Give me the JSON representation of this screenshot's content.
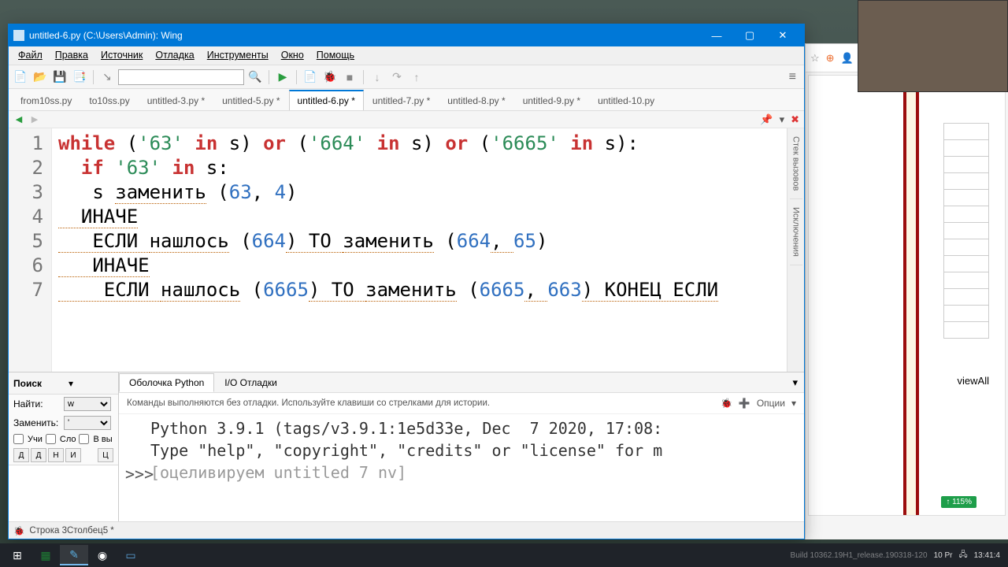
{
  "window": {
    "title": "untitled-6.py (C:\\Users\\Admin): Wing"
  },
  "menu": [
    "Файл",
    "Правка",
    "Источник",
    "Отладка",
    "Инструменты",
    "Окно",
    "Помощь"
  ],
  "tabs": [
    {
      "label": "from10ss.py",
      "active": false
    },
    {
      "label": "to10ss.py",
      "active": false
    },
    {
      "label": "untitled-3.py *",
      "active": false
    },
    {
      "label": "untitled-5.py *",
      "active": false
    },
    {
      "label": "untitled-6.py *",
      "active": true
    },
    {
      "label": "untitled-7.py *",
      "active": false
    },
    {
      "label": "untitled-8.py *",
      "active": false
    },
    {
      "label": "untitled-9.py *",
      "active": false
    },
    {
      "label": "untitled-10.py",
      "active": false
    }
  ],
  "code": {
    "line_numbers": [
      "1",
      "2",
      "3",
      "4",
      "5",
      "6",
      "7"
    ],
    "l1_1": "while ",
    "l1_2": "(",
    "l1_s1": "'63'",
    "l1_3": " in ",
    "l1_4": "s) ",
    "l1_or": "or ",
    "l1_5": "(",
    "l1_s2": "'664'",
    "l1_6": " in ",
    "l1_7": "s) ",
    "l1_8": "(",
    "l1_s3": "'6665'",
    "l1_9": " in ",
    "l1_10": "s):",
    "l2_1": "  if ",
    "l2_s1": "'63'",
    "l2_2": " in ",
    "l2_3": "s:",
    "l3_1": "   s ",
    "l3_w": "заменить",
    "l3_2": " (",
    "l3_n1": "63",
    "l3_3": ", ",
    "l3_n2": "4",
    "l3_4": ")",
    "l4": "  ИНАЧЕ",
    "l5_1": "   ЕСЛИ ",
    "l5_w1": "нашлось",
    "l5_2": " (",
    "l5_n1": "664",
    "l5_3": ") ТО ",
    "l5_w2": "заменить",
    "l5_4": " (",
    "l5_n2": "664",
    "l5_c": ", ",
    "l5_n3": "65",
    "l5_5": ")",
    "l6": "   ИНАЧЕ",
    "l7_1": "    ЕСЛИ ",
    "l7_w1": "нашлось",
    "l7_2": " (",
    "l7_n1": "6665",
    "l7_3": ") ТО ",
    "l7_w2": "заменить",
    "l7_4": " (",
    "l7_n2": "6665",
    "l7_c": ", ",
    "l7_n3": "663",
    "l7_5": ") КОНЕЦ ЕСЛИ"
  },
  "side": {
    "tab1": "Стек вызовов",
    "tab2": "Исключения"
  },
  "search": {
    "title": "Поиск",
    "find_label": "Найти:",
    "find_value": "w",
    "replace_label": "Заменить:",
    "replace_value": "'",
    "cb1": "Учи",
    "cb2": "Сло",
    "cb3": "В вы",
    "btns": [
      "Д",
      "Д",
      "Н",
      "И",
      "Ц"
    ]
  },
  "shell": {
    "tabs": [
      "Оболочка Python",
      "I/O Отладки"
    ],
    "hint": "Команды выполняются без отладки.  Используйте клавиши со стрелками для истории.",
    "opts": "Опции",
    "l1": "Python 3.9.1 (tags/v3.9.1:1e5d33e, Dec  7 2020, 17:08:",
    "l2": "Type \"help\", \"copyright\", \"credits\" or \"license\" for m",
    "l3": "[оцеливируем untitled 7 nv]",
    "prompt": ">>>"
  },
  "status": {
    "text": "Строка 3Столбец5 *"
  },
  "browser": {
    "viewall": "viewAll",
    "zoom": "115%"
  },
  "taskbar": {
    "time": "13:41:4",
    "build": "10 Pr",
    "rel": "Build 10362.19H1_release.190318-120"
  }
}
